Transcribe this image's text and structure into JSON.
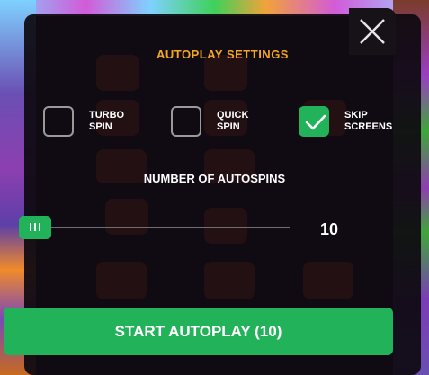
{
  "dialog": {
    "title": "AUTOPLAY SETTINGS",
    "close_icon": "close-icon"
  },
  "options": [
    {
      "label": "TURBO\nSPIN",
      "checked": false
    },
    {
      "label": "QUICK\nSPIN",
      "checked": false
    },
    {
      "label": "SKIP\nSCREENS",
      "checked": true
    }
  ],
  "autospins": {
    "label": "NUMBER OF AUTOSPINS",
    "value": "10"
  },
  "start_button": {
    "label": "START AUTOPLAY (10)"
  },
  "colors": {
    "accent_green": "#22b35a",
    "title_orange": "#f5a623",
    "panel": "#0e0a10"
  }
}
